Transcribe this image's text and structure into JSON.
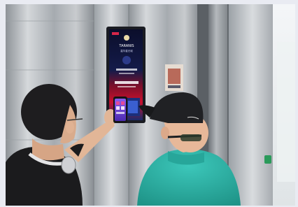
{
  "photo": {
    "screen_brand": "TARANIS",
    "screen_subtitle": "嘉华星光城",
    "colors": {
      "frame": "#e9ebf2",
      "steel_light": "#c9ccd0",
      "steel_dark": "#7d8288",
      "display_bezel": "#1a1c22",
      "display_top": "#0c0f2a",
      "display_bottom": "#c8102e",
      "phone_screen": "#6a3fd6",
      "shirt_left": "#1b1b1d",
      "shirt_right": "#2eb3a7",
      "cap": "#202124",
      "skin": "#e7b899"
    },
    "icons": [
      "elevator-call-button-icon",
      "smartphone-icon",
      "headphones-icon"
    ]
  }
}
